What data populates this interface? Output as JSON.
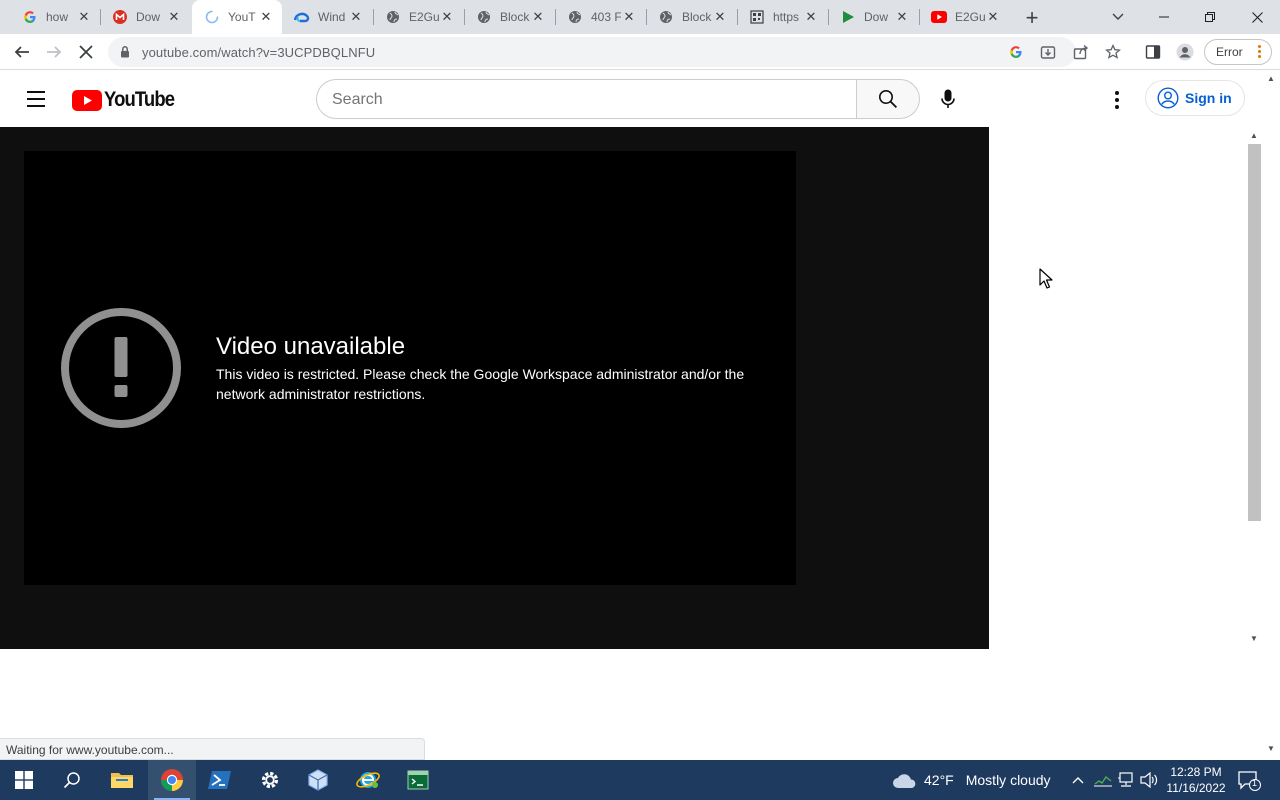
{
  "browser": {
    "tabs": [
      {
        "title": "how",
        "favicon": "google-g-icon"
      },
      {
        "title": "Dow",
        "favicon": "red-m-icon"
      },
      {
        "title": "YouT",
        "favicon": "loading-spinner-icon",
        "active": true
      },
      {
        "title": "Wind",
        "favicon": "edge-icon"
      },
      {
        "title": "E2Gu",
        "favicon": "globe-icon"
      },
      {
        "title": "Block",
        "favicon": "globe-icon"
      },
      {
        "title": "403 F",
        "favicon": "globe-icon"
      },
      {
        "title": "Block",
        "favicon": "globe-icon"
      },
      {
        "title": "https",
        "favicon": "qr-icon"
      },
      {
        "title": "Dow",
        "favicon": "green-play-icon"
      },
      {
        "title": "E2Gu",
        "favicon": "youtube-icon"
      }
    ],
    "url": "youtube.com/watch?v=3UCPDBQLNFU",
    "error_badge": "Error",
    "status_text": "Waiting for www.youtube.com..."
  },
  "youtube": {
    "logo_text": "YouTube",
    "search_placeholder": "Search",
    "sign_in_label": "Sign in",
    "player": {
      "error_title": "Video unavailable",
      "error_message": "This video is restricted. Please check the Google Workspace administrator and/or the network administrator restrictions."
    }
  },
  "taskbar": {
    "apps": [
      "start-icon",
      "search-icon",
      "file-explorer-icon",
      "chrome-icon",
      "powershell-icon",
      "settings-icon",
      "virtualbox-icon",
      "ie-icon",
      "terminal-icon"
    ],
    "weather_temp": "42°F",
    "weather_condition": "Mostly cloudy",
    "time": "12:28 PM",
    "date": "11/16/2022",
    "notification_count": "1"
  },
  "colors": {
    "youtube_red": "#ff0000",
    "link_blue": "#065fd4",
    "taskbar": "#1f3a5f"
  }
}
